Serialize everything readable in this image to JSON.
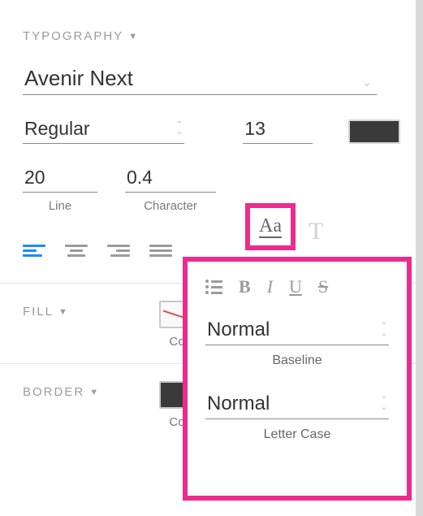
{
  "typography": {
    "header": "TYPOGRAPHY",
    "fontFamily": "Avenir Next",
    "fontWeight": "Regular",
    "fontSize": "13",
    "lineHeight": "20",
    "lineLabel": "Line",
    "characterSpacing": "0.4",
    "characterLabel": "Character"
  },
  "fill": {
    "header": "FILL",
    "colorLabel": "Co"
  },
  "border": {
    "header": "BORDER",
    "colorLabel": "Co"
  },
  "popover": {
    "baselineValue": "Normal",
    "baselineLabel": "Baseline",
    "letterCaseValue": "Normal",
    "letterCaseLabel": "Letter Case"
  },
  "icons": {
    "aa": "Aa",
    "t": "T",
    "bold": "B",
    "italic": "I",
    "underline": "U",
    "strike": "S"
  }
}
